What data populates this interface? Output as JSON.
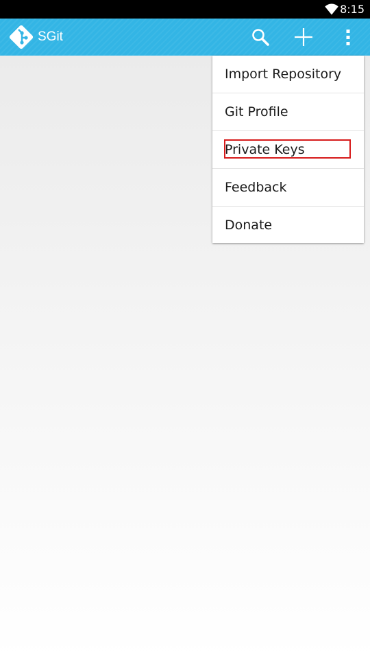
{
  "status_bar": {
    "time": "8:15",
    "wifi_icon": "wifi-icon"
  },
  "action_bar": {
    "title": "SGit",
    "logo_icon": "git-logo-icon",
    "search_icon": "search-icon",
    "add_icon": "plus-icon",
    "overflow_icon": "overflow-menu-icon",
    "background_color": "#33b5e5"
  },
  "menu": {
    "items": [
      {
        "label": "Import Repository"
      },
      {
        "label": "Git Profile"
      },
      {
        "label": "Private Keys",
        "highlighted": true
      },
      {
        "label": "Feedback"
      },
      {
        "label": "Donate"
      }
    ],
    "highlight_color": "#d61a1a"
  }
}
